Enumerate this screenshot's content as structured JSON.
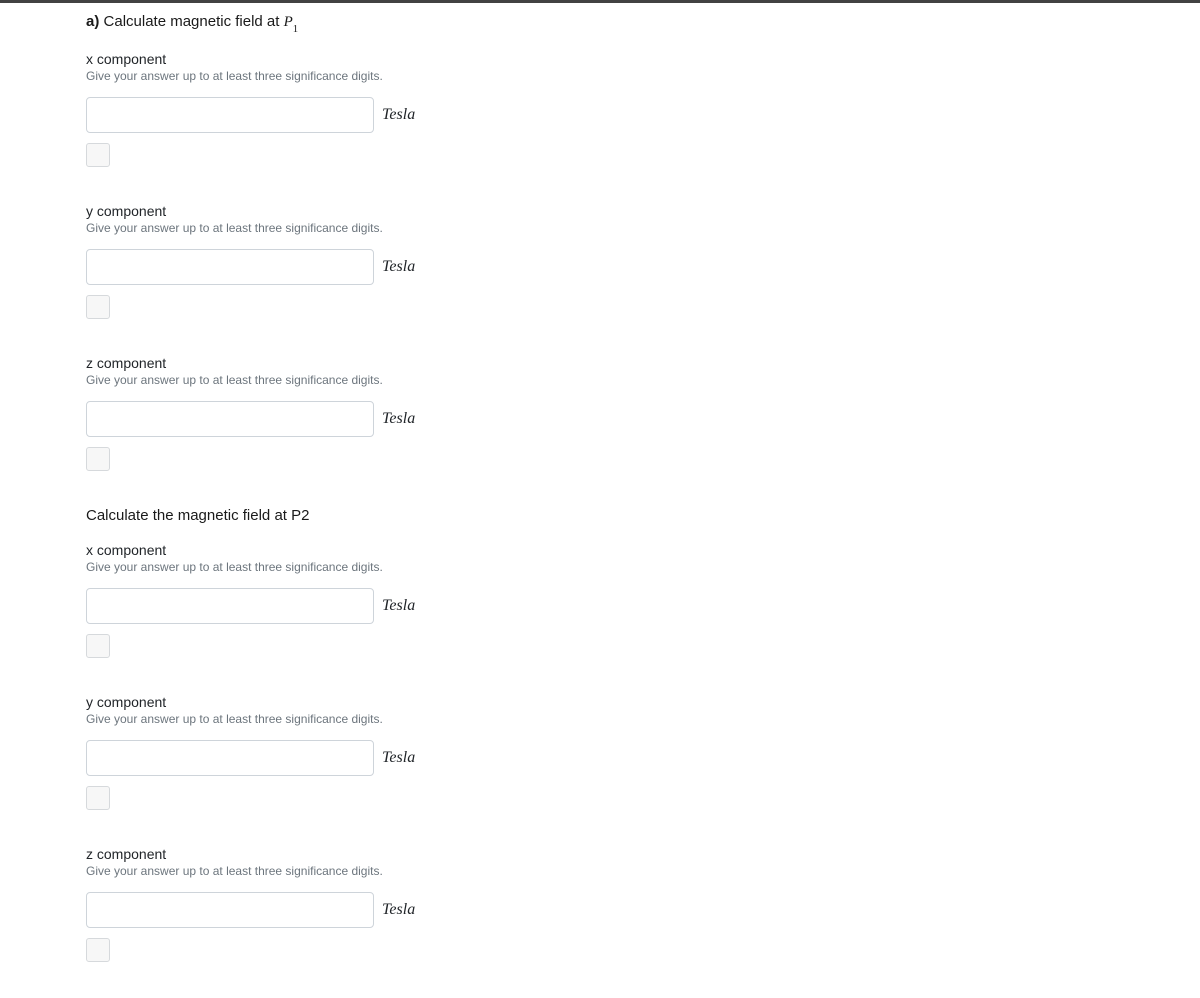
{
  "section1": {
    "part_letter": "a)",
    "title_text": "Calculate magnetic field at ",
    "point_var": "P",
    "point_sub": "1"
  },
  "section2": {
    "title_text": "Calculate the magnetic field at ",
    "point_var": "P",
    "point_sub": "2"
  },
  "components": {
    "x": {
      "label": "x component",
      "hint": "Give your answer up to at least three significance digits.",
      "unit": "Tesla"
    },
    "y": {
      "label": "y component",
      "hint": "Give your answer up to at least three significance digits.",
      "unit": "Tesla"
    },
    "z": {
      "label": "z component",
      "hint": "Give your answer up to at least three significance digits.",
      "unit": "Tesla"
    }
  }
}
